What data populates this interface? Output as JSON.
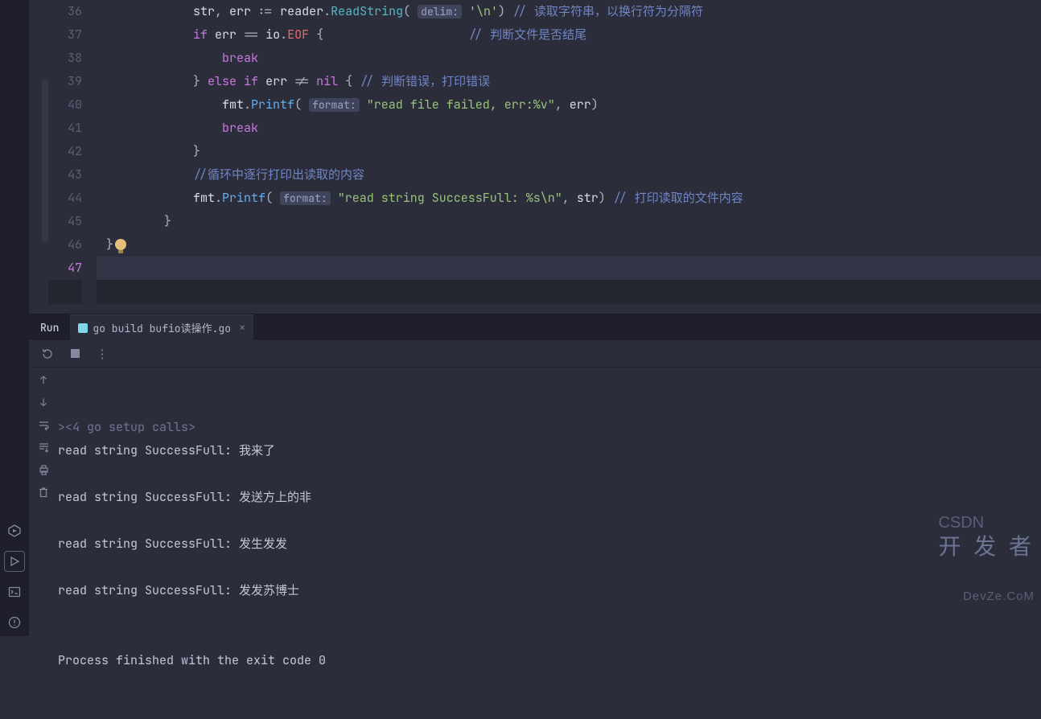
{
  "editor": {
    "startLine": 36,
    "highlightLine": 47,
    "lines": [
      {
        "n": 36,
        "html": "            <span class='var'>str</span><span class='punc'>, </span><span class='var'>err</span><span class='punc'> := </span><span class='var'>reader</span><span class='punc'>.</span><span class='fncall'>ReadString</span><span class='punc'>( </span><span class='hint'>delim:</span><span class='punc'> </span><span class='str'>'\\n'</span><span class='punc'>) </span><span class='cmt'>// 读取字符串，以换行符为分隔符</span>"
      },
      {
        "n": 37,
        "html": "            <span class='kw'>if</span><span class='punc'> </span><span class='var'>err</span><span class='punc'> == </span><span class='var'>io</span><span class='punc'>.</span><span class='ident'>EOF</span><span class='punc'> {</span>                    <span class='cmt'>// 判断文件是否结尾</span>"
      },
      {
        "n": 38,
        "html": "                <span class='kw'>break</span>"
      },
      {
        "n": 39,
        "html": "            <span class='punc'>}</span> <span class='kw'>else if</span><span class='punc'> </span><span class='var'>err</span><span class='punc'> != </span><span class='kw'>nil</span><span class='punc'> { </span><span class='cmt'>// 判断错误，打印错误</span>"
      },
      {
        "n": 40,
        "html": "                <span class='var'>fmt</span><span class='punc'>.</span><span class='fn'>Printf</span><span class='punc'>( </span><span class='hint'>format:</span><span class='punc'> </span><span class='str'>\"read file failed, err:%v\"</span><span class='punc'>, </span><span class='var'>err</span><span class='punc'>)</span>"
      },
      {
        "n": 41,
        "html": "                <span class='kw'>break</span>"
      },
      {
        "n": 42,
        "html": "            <span class='punc'>}</span>"
      },
      {
        "n": 43,
        "html": "            <span class='cmt'>//循环中逐行打印出读取的内容</span>"
      },
      {
        "n": 44,
        "html": "            <span class='var'>fmt</span><span class='punc'>.</span><span class='fn'>Printf</span><span class='punc'>( </span><span class='hint'>format:</span><span class='punc'> </span><span class='str'>\"read string SuccessFull: %s\\n\"</span><span class='punc'>, </span><span class='var'>str</span><span class='punc'>) </span><span class='cmt'>// 打印读取的文件内容</span>"
      },
      {
        "n": 45,
        "html": "        <span class='punc'>}</span>"
      },
      {
        "n": 46,
        "html": "<span class='punc'>}</span><span class='bulb'></span>"
      },
      {
        "n": 47,
        "html": ""
      }
    ]
  },
  "runPanel": {
    "label": "Run",
    "tabTitle": "go build bufio读操作.go",
    "consoleLines": [
      {
        "cls": "dim",
        "text": "><4 go setup calls>"
      },
      {
        "cls": "",
        "text": "read string SuccessFull: 我来了"
      },
      {
        "cls": "",
        "text": ""
      },
      {
        "cls": "",
        "text": "read string SuccessFull: 发送方上的非"
      },
      {
        "cls": "",
        "text": ""
      },
      {
        "cls": "",
        "text": "read string SuccessFull: 发生发发"
      },
      {
        "cls": "",
        "text": ""
      },
      {
        "cls": "",
        "text": "read string SuccessFull: 发发苏博士"
      },
      {
        "cls": "",
        "text": ""
      },
      {
        "cls": "",
        "text": ""
      },
      {
        "cls": "",
        "text": "Process finished with the exit code 0"
      }
    ]
  },
  "watermark": {
    "small": "CSDN",
    "big": "开 发 者",
    "sub": "DevZe.CoM"
  }
}
